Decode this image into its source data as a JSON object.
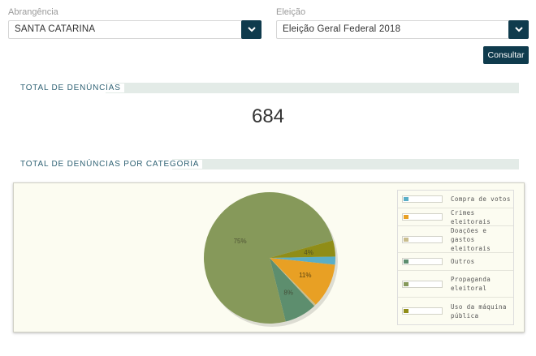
{
  "filters": {
    "abrangencia": {
      "label": "Abrangência",
      "value": "SANTA CATARINA"
    },
    "eleicao": {
      "label": "Eleição",
      "value": "Eleição Geral Federal 2018"
    }
  },
  "consult_button": "Consultar",
  "total_section": {
    "title": "TOTAL DE DENÚNCIAS",
    "value": "684"
  },
  "category_section": {
    "title": "TOTAL DE DENÚNCIAS POR CATEGORIA"
  },
  "colors": {
    "dark_teal": "#0f3b4d",
    "section_bar": "#e3ebe7",
    "chart_bg": "#fcfcf1"
  },
  "chart_data": {
    "type": "pie",
    "series": [
      {
        "name": "Compra de votos",
        "value": 2,
        "label": "",
        "color": "#5aaec6"
      },
      {
        "name": "Crimes eleitorais",
        "value": 11,
        "label": "11%",
        "color": "#e8a024"
      },
      {
        "name": "Doações e gastos eleitorais",
        "value": 0.5,
        "label": "",
        "color": "#c9bd8c"
      },
      {
        "name": "Outros",
        "value": 8,
        "label": "8%",
        "color": "#5d8e6e"
      },
      {
        "name": "Propaganda eleitoral",
        "value": 75,
        "label": "75%",
        "color": "#86995a"
      },
      {
        "name": "Uso da máquina pública",
        "value": 4,
        "label": "4%",
        "color": "#908d17"
      }
    ],
    "legend_position": "right"
  }
}
